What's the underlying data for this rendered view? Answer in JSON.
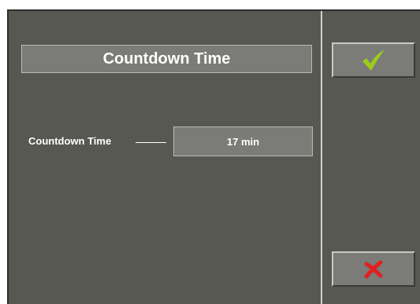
{
  "dialog": {
    "title": "Countdown Time"
  },
  "field": {
    "label": "Countdown Time",
    "value": "17 min"
  },
  "buttons": {
    "confirm_icon": "checkmark-icon",
    "cancel_icon": "cross-icon"
  },
  "colors": {
    "panel_background": "#585853",
    "field_background": "#7b7b77",
    "checkmark": "#9ccc1a",
    "cross": "#e02020",
    "text": "#ffffff"
  }
}
